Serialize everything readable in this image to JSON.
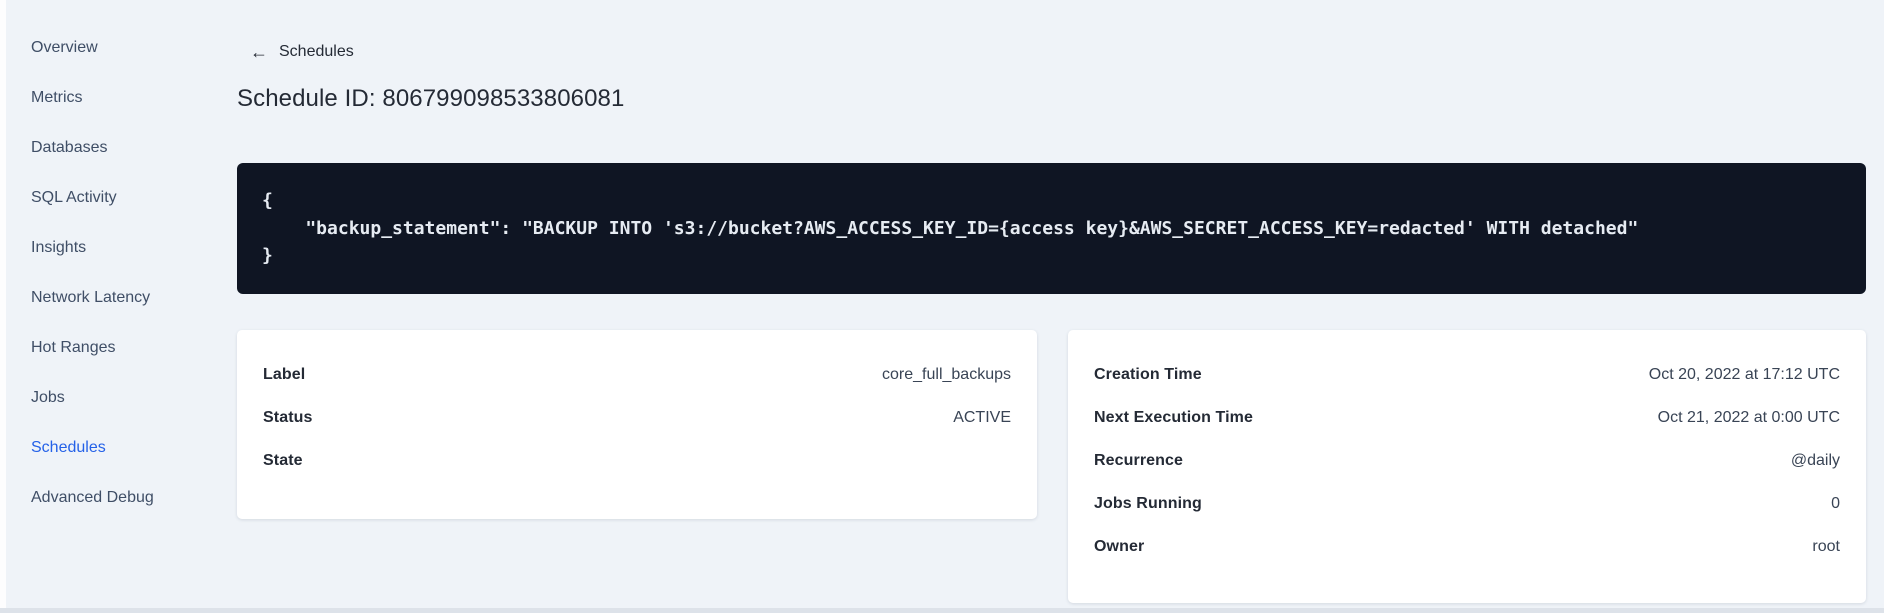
{
  "colors": {
    "page_bg": "#eff3f8",
    "accent_blue": "#2461e8",
    "code_bg": "#0f1523",
    "code_text": "#e6ebf2",
    "text_dark": "#242a35"
  },
  "sidebar": {
    "items": [
      {
        "label": "Overview",
        "active": false
      },
      {
        "label": "Metrics",
        "active": false
      },
      {
        "label": "Databases",
        "active": false
      },
      {
        "label": "SQL Activity",
        "active": false
      },
      {
        "label": "Insights",
        "active": false
      },
      {
        "label": "Network Latency",
        "active": false
      },
      {
        "label": "Hot Ranges",
        "active": false
      },
      {
        "label": "Jobs",
        "active": false
      },
      {
        "label": "Schedules",
        "active": true
      },
      {
        "label": "Advanced Debug",
        "active": false
      }
    ]
  },
  "header": {
    "back_icon": "←",
    "back_label": "Schedules",
    "title": "Schedule ID: 806799098533806081"
  },
  "code_block": {
    "lines": [
      "{",
      "    \"backup_statement\": \"BACKUP INTO 's3://bucket?AWS_ACCESS_KEY_ID={access key}&AWS_SECRET_ACCESS_KEY=redacted' WITH detached\"",
      "}"
    ]
  },
  "details_left": {
    "rows": [
      {
        "label": "Label",
        "value": "core_full_backups"
      },
      {
        "label": "Status",
        "value": "ACTIVE"
      },
      {
        "label": "State",
        "value": ""
      }
    ]
  },
  "details_right": {
    "rows": [
      {
        "label": "Creation Time",
        "value": "Oct 20, 2022 at 17:12 UTC"
      },
      {
        "label": "Next Execution Time",
        "value": "Oct 21, 2022 at 0:00 UTC"
      },
      {
        "label": "Recurrence",
        "value": "@daily"
      },
      {
        "label": "Jobs Running",
        "value": "0"
      },
      {
        "label": "Owner",
        "value": "root"
      }
    ]
  }
}
